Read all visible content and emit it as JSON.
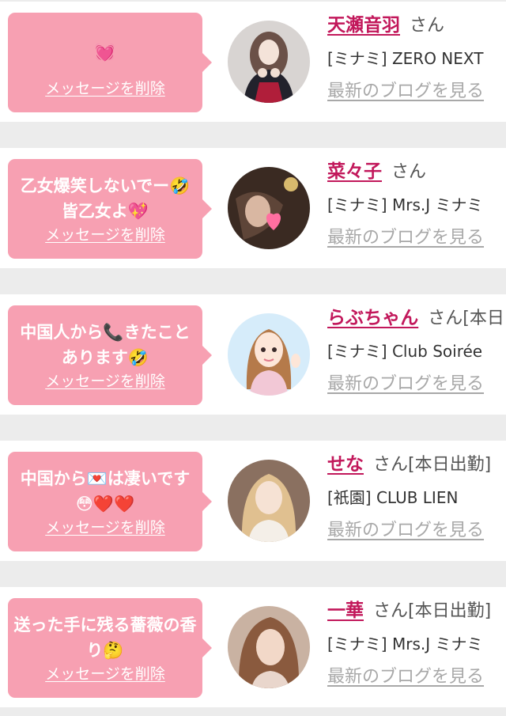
{
  "messages": [
    {
      "text": "💓",
      "delete_label": "メッセージを削除",
      "name": "天瀬音羽",
      "suffix": "さん",
      "shop": "[ミナミ] ZERO NEXT",
      "blog_label": "最新のブログを見る",
      "avatar": "photo-girl-in-black-dress"
    },
    {
      "text": "乙女爆笑しないでー🤣皆乙女よ💖",
      "delete_label": "メッセージを削除",
      "name": "菜々子",
      "suffix": "さん",
      "shop": "[ミナミ] Mrs.J ミナミ",
      "blog_label": "最新のブログを見る",
      "avatar": "photo-with-heart-sticker"
    },
    {
      "text": "中国人から📞きたことあります🤣",
      "delete_label": "メッセージを削除",
      "name": "らぶちゃん",
      "suffix": "さん[本日",
      "shop": "[ミナミ] Club Soirée",
      "blog_label": "最新のブログを見る",
      "avatar": "illustration-waving-girl"
    },
    {
      "text": "中国から💌は凄いです😳❤️❤️",
      "delete_label": "メッセージを削除",
      "name": "せな",
      "suffix": "さん[本日出勤]",
      "shop": "[祇園] CLUB LIEN",
      "blog_label": "最新のブログを見る",
      "avatar": "photo-blonde-girl"
    },
    {
      "text": "送った手に残る薔薇の香り🤔",
      "delete_label": "メッセージを削除",
      "name": "一華",
      "suffix": "さん[本日出勤]",
      "shop": "[ミナミ] Mrs.J ミナミ",
      "blog_label": "最新のブログを見る",
      "avatar": "photo-long-hair-selfie"
    }
  ],
  "colors": {
    "bubble": "#f7a0b2",
    "name_link": "#c2185b",
    "blog_link": "#a8a8a8",
    "page_bg": "#ececec"
  }
}
